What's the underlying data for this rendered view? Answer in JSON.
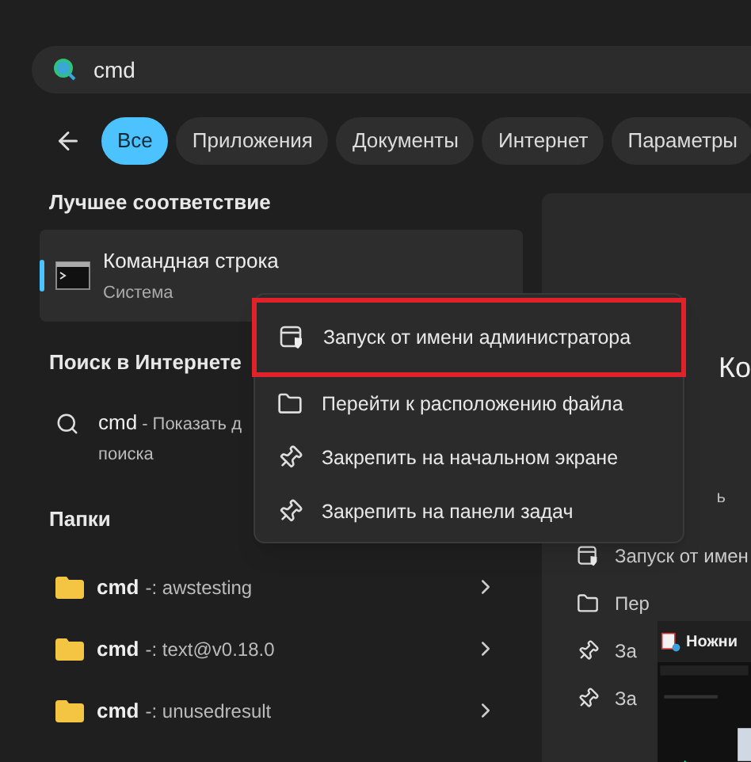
{
  "search": {
    "value": "cmd"
  },
  "filters": [
    {
      "label": "Все",
      "selected": true
    },
    {
      "label": "Приложения",
      "selected": false
    },
    {
      "label": "Документы",
      "selected": false
    },
    {
      "label": "Интернет",
      "selected": false
    },
    {
      "label": "Параметры",
      "selected": false
    }
  ],
  "best_match": {
    "heading": "Лучшее соответствие",
    "title": "Командная строка",
    "subtitle": "Система",
    "selected": true
  },
  "web": {
    "heading": "Поиск в Интернете",
    "query": "cmd",
    "hint": "- Показать д",
    "hint_line2": "поиска"
  },
  "folders": {
    "heading": "Папки",
    "items": [
      {
        "name": "cmd",
        "path": "-: awstesting"
      },
      {
        "name": "cmd",
        "path": "-: text@v0.18.0"
      },
      {
        "name": "cmd",
        "path": "-: unusedresult"
      }
    ]
  },
  "context_menu": [
    {
      "kind": "admin",
      "label": "Запуск от имени администратора",
      "highlighted": true
    },
    {
      "kind": "folder",
      "label": "Перейти к расположению файла",
      "highlighted": false
    },
    {
      "kind": "pin",
      "label": "Закрепить на начальном экране",
      "highlighted": false
    },
    {
      "kind": "pin",
      "label": "Закрепить на панели задач",
      "highlighted": false
    }
  ],
  "preview": {
    "title": "Ко",
    "fragment": "ь",
    "actions": [
      {
        "kind": "admin",
        "label": "Запуск от имен"
      },
      {
        "kind": "folder",
        "label": "Пер"
      },
      {
        "kind": "pin",
        "label": "За"
      },
      {
        "kind": "pin",
        "label": "За"
      }
    ]
  },
  "snip_window": {
    "title": "Ножни"
  }
}
